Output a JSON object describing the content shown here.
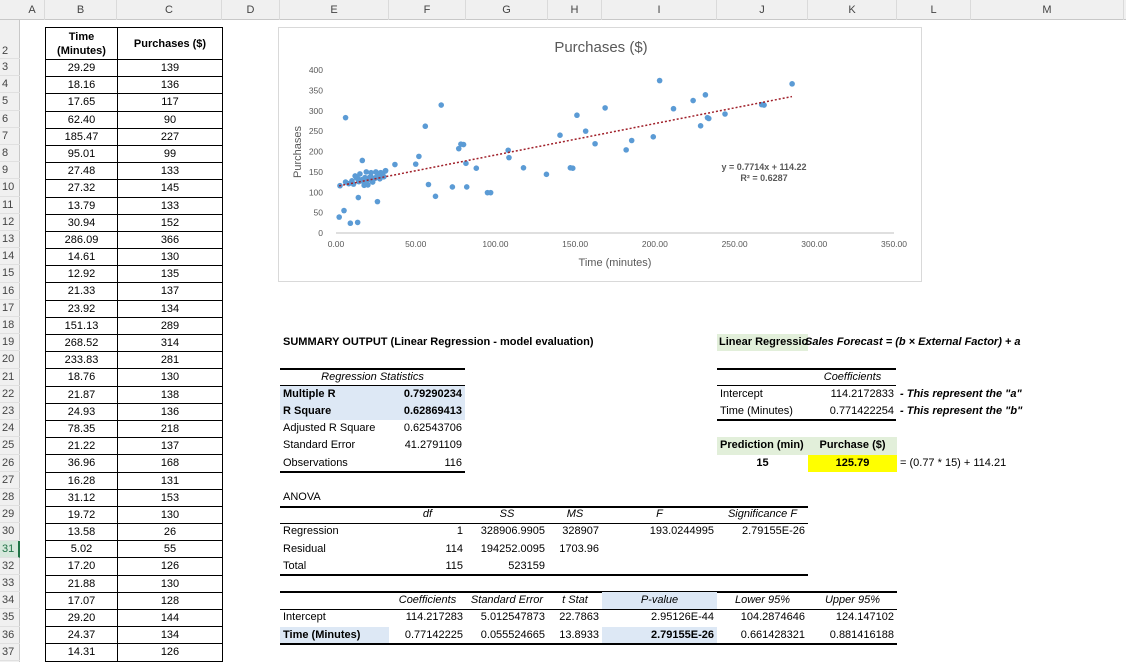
{
  "columns": [
    "A",
    "B",
    "C",
    "D",
    "E",
    "F",
    "G",
    "H",
    "I",
    "J",
    "K",
    "L",
    "M"
  ],
  "row_numbers": [
    "2",
    "3",
    "4",
    "5",
    "6",
    "7",
    "8",
    "9",
    "10",
    "11",
    "12",
    "13",
    "14",
    "15",
    "16",
    "17",
    "18",
    "19",
    "20",
    "21",
    "22",
    "23",
    "24",
    "25",
    "26",
    "27",
    "28",
    "29",
    "30",
    "31",
    "32",
    "33",
    "34",
    "35",
    "36",
    "37"
  ],
  "selected_row": "31",
  "data_table": {
    "headers": [
      "Time (Minutes)",
      "Purchases ($)"
    ],
    "rows": [
      [
        "29.29",
        "139"
      ],
      [
        "18.16",
        "136"
      ],
      [
        "17.65",
        "117"
      ],
      [
        "62.40",
        "90"
      ],
      [
        "185.47",
        "227"
      ],
      [
        "95.01",
        "99"
      ],
      [
        "27.48",
        "133"
      ],
      [
        "27.32",
        "145"
      ],
      [
        "13.79",
        "133"
      ],
      [
        "30.94",
        "152"
      ],
      [
        "286.09",
        "366"
      ],
      [
        "14.61",
        "130"
      ],
      [
        "12.92",
        "135"
      ],
      [
        "21.33",
        "137"
      ],
      [
        "23.92",
        "134"
      ],
      [
        "151.13",
        "289"
      ],
      [
        "268.52",
        "314"
      ],
      [
        "233.83",
        "281"
      ],
      [
        "18.76",
        "130"
      ],
      [
        "21.87",
        "138"
      ],
      [
        "24.93",
        "136"
      ],
      [
        "78.35",
        "218"
      ],
      [
        "21.22",
        "137"
      ],
      [
        "36.96",
        "168"
      ],
      [
        "16.28",
        "131"
      ],
      [
        "31.12",
        "153"
      ],
      [
        "19.72",
        "130"
      ],
      [
        "13.58",
        "26"
      ],
      [
        "5.02",
        "55"
      ],
      [
        "17.20",
        "126"
      ],
      [
        "21.88",
        "130"
      ],
      [
        "17.07",
        "128"
      ],
      [
        "29.20",
        "144"
      ],
      [
        "24.37",
        "134"
      ],
      [
        "14.31",
        "126"
      ]
    ]
  },
  "summary": {
    "title": "SUMMARY OUTPUT (Linear Regression - model evaluation)",
    "reg_stats_title": "Regression Statistics",
    "reg_stats": [
      {
        "label": "Multiple R",
        "value": "0.79290234"
      },
      {
        "label": "R Square",
        "value": "0.62869413"
      },
      {
        "label": "Adjusted R Square",
        "value": "0.62543706"
      },
      {
        "label": "Standard Error",
        "value": "41.2791109"
      },
      {
        "label": "Observations",
        "value": "116"
      }
    ],
    "anova_title": "ANOVA",
    "anova_headers": [
      "df",
      "SS",
      "MS",
      "F",
      "Significance F"
    ],
    "anova_rows": [
      {
        "label": "Regression",
        "df": "1",
        "ss": "328906.9905",
        "ms": "328907",
        "f": "193.0244995",
        "sig": "2.79155E-26"
      },
      {
        "label": "Residual",
        "df": "114",
        "ss": "194252.0095",
        "ms": "1703.96"
      },
      {
        "label": "Total",
        "df": "115",
        "ss": "523159"
      }
    ],
    "coef_headers": [
      "Coefficients",
      "Standard Error",
      "t Stat",
      "P-value",
      "Lower 95%",
      "Upper 95%"
    ],
    "coef_rows": [
      {
        "label": "Intercept",
        "coef": "114.217283",
        "se": "5.012547873",
        "t": "22.7863",
        "p": "2.95126E-44",
        "lower": "104.2874646",
        "upper": "124.147102"
      },
      {
        "label": "Time (Minutes)",
        "coef": "0.77142225",
        "se": "0.055524665",
        "t": "13.8933",
        "p": "2.79155E-26",
        "lower": "0.661428321",
        "upper": "0.881416188"
      }
    ]
  },
  "model": {
    "title": "Linear Regression Model - foreca",
    "formula": "Sales Forecast = (b × External Factor) + a",
    "coef_header": "Coefficients",
    "intercept_label": "Intercept",
    "intercept_value": "114.2172833",
    "intercept_note": "- This represent the \"a\"",
    "slope_label": "Time (Minutes)",
    "slope_value": "0.771422254",
    "slope_note": "- This represent the \"b\"",
    "prediction_label": "Prediction (min)",
    "purchase_label": "Purchase ($)",
    "prediction_value": "15",
    "purchase_value": "125.79",
    "calc_note": "= (0.77 * 15) + 114.21"
  },
  "colors": {
    "point": "#5b9bd5",
    "trend": "#a0202a",
    "highlight_blue": "#dde8f5",
    "highlight_green": "#e2efda",
    "highlight_yellow": "#ffff00"
  },
  "chart_data": {
    "type": "scatter",
    "title": "Purchases ($)",
    "xlabel": "Time (minutes)",
    "ylabel": "Purchases",
    "xlim": [
      0,
      350
    ],
    "ylim": [
      0,
      400
    ],
    "xticks": [
      "0.00",
      "50.00",
      "100.00",
      "150.00",
      "200.00",
      "250.00",
      "300.00",
      "350.00"
    ],
    "yticks": [
      "0",
      "50",
      "100",
      "150",
      "200",
      "250",
      "300",
      "350",
      "400"
    ],
    "grid": false,
    "trendline": {
      "slope": 0.7714,
      "intercept": 114.22,
      "x_range": [
        2,
        286
      ],
      "equation": "y = 0.7714x + 114.22",
      "r2": "R² = 0.6287"
    },
    "points": [
      [
        29.29,
        139
      ],
      [
        18.16,
        136
      ],
      [
        17.65,
        117
      ],
      [
        62.4,
        90
      ],
      [
        185.47,
        227
      ],
      [
        95.01,
        99
      ],
      [
        27.48,
        133
      ],
      [
        27.32,
        145
      ],
      [
        13.79,
        133
      ],
      [
        30.94,
        152
      ],
      [
        286.09,
        366
      ],
      [
        14.61,
        130
      ],
      [
        12.92,
        135
      ],
      [
        21.33,
        137
      ],
      [
        23.92,
        134
      ],
      [
        151.13,
        289
      ],
      [
        268.52,
        314
      ],
      [
        233.83,
        281
      ],
      [
        18.76,
        130
      ],
      [
        21.87,
        138
      ],
      [
        24.93,
        136
      ],
      [
        78.35,
        218
      ],
      [
        21.22,
        137
      ],
      [
        36.96,
        168
      ],
      [
        16.28,
        131
      ],
      [
        31.12,
        153
      ],
      [
        19.72,
        130
      ],
      [
        13.58,
        26
      ],
      [
        5.02,
        55
      ],
      [
        17.2,
        126
      ],
      [
        21.88,
        130
      ],
      [
        17.07,
        128
      ],
      [
        29.2,
        144
      ],
      [
        24.37,
        134
      ],
      [
        14.31,
        126
      ],
      [
        2,
        39
      ],
      [
        9,
        24
      ],
      [
        14,
        87
      ],
      [
        26,
        77
      ],
      [
        6,
        283
      ],
      [
        2.5,
        116
      ],
      [
        16.5,
        178
      ],
      [
        50,
        169
      ],
      [
        52,
        188
      ],
      [
        56,
        262
      ],
      [
        58,
        119
      ],
      [
        66,
        314
      ],
      [
        73,
        113
      ],
      [
        77,
        207
      ],
      [
        80,
        217
      ],
      [
        81.5,
        171
      ],
      [
        82,
        113
      ],
      [
        88,
        159
      ],
      [
        97,
        99
      ],
      [
        108,
        203
      ],
      [
        108.5,
        185
      ],
      [
        117.6,
        160
      ],
      [
        132,
        144
      ],
      [
        140.5,
        240
      ],
      [
        147,
        160
      ],
      [
        148.5,
        159
      ],
      [
        156.6,
        250
      ],
      [
        168.8,
        307
      ],
      [
        162.5,
        219
      ],
      [
        182,
        204
      ],
      [
        199,
        236
      ],
      [
        203,
        374
      ],
      [
        211.7,
        305
      ],
      [
        224,
        325
      ],
      [
        231.7,
        339
      ],
      [
        228.7,
        263
      ],
      [
        233,
        283
      ],
      [
        244,
        292
      ],
      [
        267,
        315
      ],
      [
        6,
        125
      ],
      [
        8,
        121
      ],
      [
        10,
        128
      ],
      [
        11,
        120
      ],
      [
        12,
        140
      ],
      [
        15,
        145
      ],
      [
        19,
        150
      ],
      [
        20,
        118
      ],
      [
        22,
        148
      ],
      [
        23,
        125
      ],
      [
        25,
        150
      ],
      [
        26,
        142
      ],
      [
        28,
        148
      ],
      [
        30,
        138
      ]
    ]
  }
}
